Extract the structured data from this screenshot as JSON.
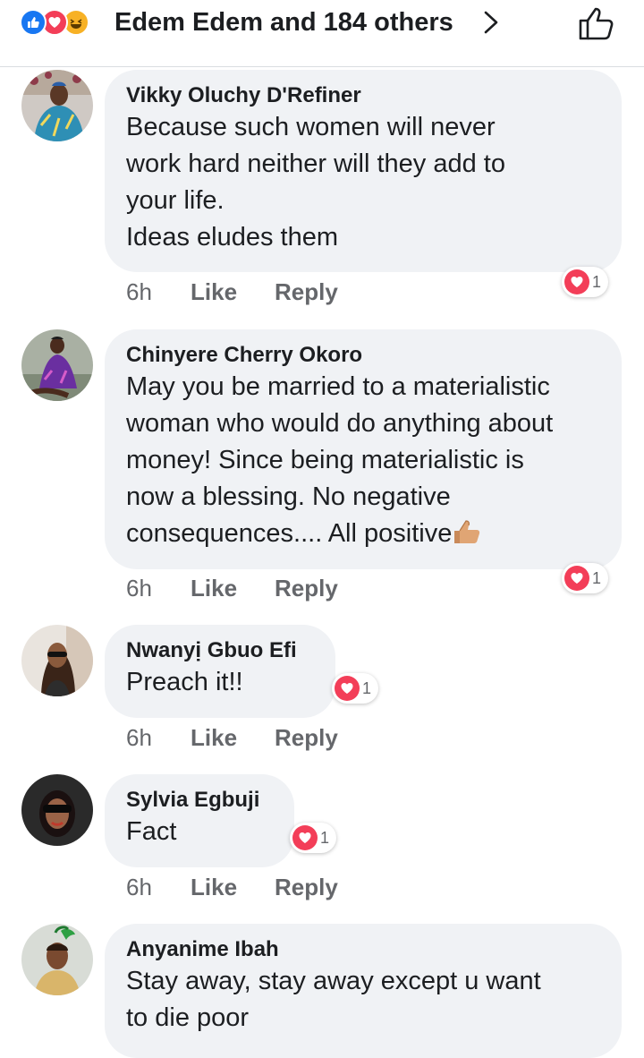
{
  "header": {
    "reactions_summary": "Edem Edem and 184 others",
    "reaction_icons": [
      "like-icon",
      "love-icon",
      "haha-icon"
    ]
  },
  "colors": {
    "like_blue": "#1877f2",
    "love_red": "#f33e58",
    "haha_yellow": "#f7b125",
    "bubble_bg": "#f0f2f5",
    "meta_gray": "#65676b"
  },
  "comments": [
    {
      "author": "Vikky Oluchy D'Refiner",
      "lines": [
        "Because such women will never",
        "work hard neither will they add to",
        "your life.",
        "Ideas eludes them"
      ],
      "time": "6h",
      "like_label": "Like",
      "reply_label": "Reply",
      "reaction_count": "1"
    },
    {
      "author": "Chinyere Cherry Okoro",
      "lines": [
        "May you be married to a materialistic",
        "woman who would do anything about",
        "money! Since being materialistic is",
        "now a blessing. No negative",
        "consequences.... All positive"
      ],
      "time": "6h",
      "like_label": "Like",
      "reply_label": "Reply",
      "reaction_count": "1"
    },
    {
      "author": "Nwanyị Gbuo Efi",
      "lines": [
        "Preach it!!"
      ],
      "time": "6h",
      "like_label": "Like",
      "reply_label": "Reply",
      "reaction_count": "1"
    },
    {
      "author": "Sylvia Egbuji",
      "lines": [
        "Fact"
      ],
      "time": "6h",
      "like_label": "Like",
      "reply_label": "Reply",
      "reaction_count": "1"
    },
    {
      "author": "Anyanime Ibah",
      "lines": [
        "Stay away, stay away except u want",
        "to die poor"
      ]
    }
  ]
}
